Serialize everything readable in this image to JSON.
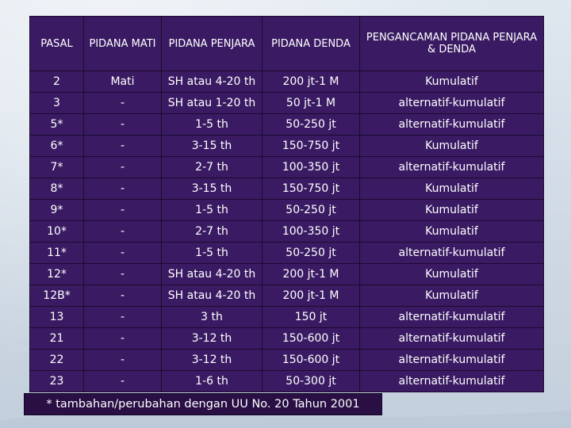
{
  "table": {
    "headers": [
      "PASAL",
      "PIDANA MATI",
      "PIDANA PENJARA",
      "PIDANA DENDA",
      "PENGANCAMAN PIDANA PENJARA & DENDA"
    ],
    "rows": [
      [
        "2",
        "Mati",
        "SH atau 4-20 th",
        "200 jt-1 M",
        "Kumulatif"
      ],
      [
        "3",
        "-",
        "SH atau 1-20 th",
        "50 jt-1 M",
        "alternatif-kumulatif"
      ],
      [
        "5*",
        "-",
        "1-5 th",
        "50-250 jt",
        "alternatif-kumulatif"
      ],
      [
        "6*",
        "-",
        "3-15 th",
        "150-750 jt",
        "Kumulatif"
      ],
      [
        "7*",
        "-",
        "2-7 th",
        "100-350 jt",
        "alternatif-kumulatif"
      ],
      [
        "8*",
        "-",
        "3-15 th",
        "150-750 jt",
        "Kumulatif"
      ],
      [
        "9*",
        "-",
        "1-5 th",
        "50-250 jt",
        "Kumulatif"
      ],
      [
        "10*",
        "-",
        "2-7 th",
        "100-350 jt",
        "Kumulatif"
      ],
      [
        "11*",
        "-",
        "1-5 th",
        "50-250 jt",
        "alternatif-kumulatif"
      ],
      [
        "12*",
        "-",
        "SH atau 4-20 th",
        "200 jt-1 M",
        "Kumulatif"
      ],
      [
        "12B*",
        "-",
        "SH atau 4-20 th",
        "200 jt-1 M",
        "Kumulatif"
      ],
      [
        "13",
        "-",
        "3 th",
        "150 jt",
        "alternatif-kumulatif"
      ],
      [
        "21",
        "-",
        "3-12 th",
        "150-600 jt",
        "alternatif-kumulatif"
      ],
      [
        "22",
        "-",
        "3-12 th",
        "150-600 jt",
        "alternatif-kumulatif"
      ],
      [
        "23",
        "-",
        "1-6 th",
        "50-300 jt",
        "alternatif-kumulatif"
      ]
    ]
  },
  "footnote": "* tambahan/perubahan dengan UU No. 20 Tahun 2001",
  "colors": {
    "table_bg": "#3a1b63",
    "text": "#ffffff",
    "footnote_bg": "#2a0f45"
  }
}
